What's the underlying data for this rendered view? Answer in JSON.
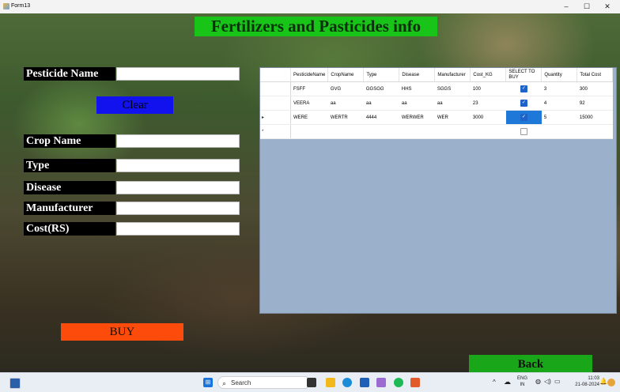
{
  "window": {
    "title": "Form13",
    "minimize": "–",
    "maximize": "☐",
    "close": "✕"
  },
  "heading": "Fertilizers and Pasticides info",
  "form": {
    "pesticide_name_label": "Pesticide Name",
    "pesticide_name_value": "",
    "clear_label": "Clear",
    "crop_name_label": "Crop Name",
    "crop_name_value": "",
    "type_label": "Type",
    "type_value": "",
    "disease_label": "Disease",
    "disease_value": "",
    "manufacturer_label": "Manufacturer",
    "manufacturer_value": "",
    "cost_label": "Cost(RS)",
    "cost_value": "",
    "buy_label": "BUY",
    "back_label": "Back"
  },
  "grid": {
    "columns": [
      "PesticideName",
      "CropName",
      "Type",
      "Disease",
      "Manufacturer",
      "Cost_KG",
      "SELECT TO BUY",
      "Quantity",
      "Total Cost"
    ],
    "rows": [
      {
        "marker": "",
        "cells": [
          "FSFF",
          "GVG",
          "GGSGG",
          "HHS",
          "SGGS",
          "100"
        ],
        "checked": true,
        "quantity": "3",
        "total": "300"
      },
      {
        "marker": "",
        "cells": [
          "VEERA",
          "aa",
          "aa",
          "aa",
          "aa",
          "23"
        ],
        "checked": true,
        "quantity": "4",
        "total": "92"
      },
      {
        "marker": "▸",
        "cells": [
          "WERE",
          "WERTR",
          "4444",
          "WERWER",
          "WER",
          "3000"
        ],
        "checked": true,
        "quantity": "5",
        "total": "15000"
      },
      {
        "marker": "*",
        "cells": [
          "",
          "",
          "",
          "",
          "",
          ""
        ],
        "checked": false,
        "quantity": "",
        "total": ""
      }
    ]
  },
  "taskbar": {
    "search_placeholder": "Search",
    "lang": "ENG",
    "region": "IN",
    "time": "11:03",
    "date": "21-08-2024"
  },
  "colors": {
    "heading_bg": "#18c418",
    "clear_bg": "#1212ee",
    "buy_bg": "#fc4b0a",
    "back_bg": "#19a619",
    "grid_bg": "#9bb1cb",
    "selected_cell": "#1e78d8"
  }
}
